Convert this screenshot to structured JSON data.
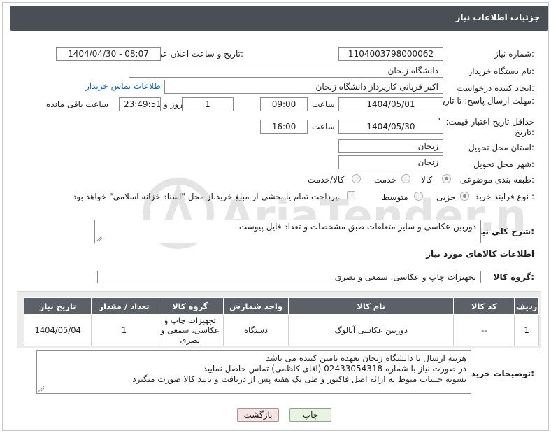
{
  "header": {
    "title": "جزئیات اطلاعات نیاز"
  },
  "fields": {
    "need_number_label": "شماره نیاز:",
    "need_number": "1104003798000062",
    "announce_label": "تاریخ و ساعت اعلان عمومی:",
    "announce_value": "1404/04/30 - 08:07",
    "buyer_org_label": "نام دستگاه خریدار:",
    "buyer_org": "دانشگاه زنجان",
    "creator_label": "ایجاد کننده درخواست:",
    "creator": "اکبر قربانی کارپرداز دانشگاه زنجان",
    "contact_link": "اطلاعات تماس خریدار",
    "reply_deadline_label": "مهلت ارسال پاسخ: تا تاریخ:",
    "reply_date": "1404/05/01",
    "time_label": "ساعت",
    "reply_time": "09:00",
    "days_count": "1",
    "days_label": "روز و",
    "remaining_time": "23:49:51",
    "remaining_label": "ساعت باقی مانده",
    "price_validity_label": "حداقل تاریخ اعتبار قیمت: تا تاریخ:",
    "price_date": "1404/05/30",
    "time_label2": "ساعت",
    "price_time": "16:00",
    "province_label": "استان محل تحویل:",
    "province": "زنجان",
    "city_label": "شهر محل تحویل:",
    "city": "زنجان",
    "category_label": "طبقه بندی موضوعی:",
    "category_options": [
      "کالا",
      "خدمت",
      "کالا/خدمت"
    ],
    "process_label": "نوع فرآیند خرید :",
    "process_options": [
      "جزیی",
      "متوسط"
    ],
    "payment_note": "پرداخت تمام یا بخشی از مبلغ خرید،از محل \"اسناد خزانه اسلامی\" خواهد بود."
  },
  "description": {
    "label": "شرح کلی نیاز:",
    "value": "دوربین عکاسی و سایر متعلقات طبق مشخصات و تعداد فایل پیوست"
  },
  "goods_section": {
    "title": "اطلاعات کالاهای مورد نیاز",
    "group_label": "گروه کالا:",
    "group_value": "تجهیزات چاپ و عکاسی، سمعی و بصری"
  },
  "table": {
    "headers": [
      "ردیف",
      "کد کالا",
      "نام کالا",
      "واحد شمارش",
      "گروه کالا",
      "تعداد / مقدار",
      "تاریخ نیاز"
    ],
    "rows": [
      [
        "1",
        "--",
        "دوربین عکاسی آنالوگ",
        "دستگاه",
        "تجهیزات چاپ و عکاسی، سمعی و بصری",
        "1",
        "1404/05/04"
      ]
    ]
  },
  "buyer_notes": {
    "label": "توضیحات خریدار:",
    "lines": [
      "هزینه ارسال تا دانشگاه زنجان بعهده تامین کننده می باشد",
      "در صورت نیاز با شماره 02433054318 (آقای کاظمی) تماس حاصل نمایید",
      "تسویه حساب منوط به ارائه اصل فاکتور و طی یک هفته پس از دریافت و تایید کالا صورت میگیرد"
    ]
  },
  "buttons": {
    "print": "چاپ",
    "back": "بازگشت"
  },
  "watermark_text": "AriaTender.neT",
  "colors": {
    "header_bg": "#4a4f56",
    "table_header_bg": "#5c6168",
    "link": "#1a5fb4",
    "print_btn": "#e6f4e0",
    "back_btn": "#f6e3e3"
  }
}
